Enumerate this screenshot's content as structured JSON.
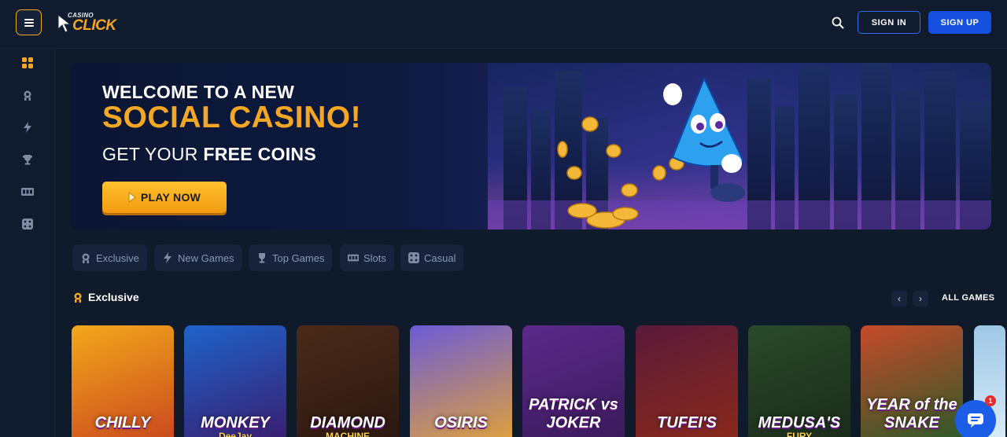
{
  "header": {
    "logo_small": "CASINO",
    "logo_big": "CLICK",
    "signin_label": "SIGN IN",
    "signup_label": "SIGN UP"
  },
  "sidebar": {
    "items": [
      {
        "icon": "grid-icon",
        "active": true
      },
      {
        "icon": "crown-medal-icon",
        "active": false
      },
      {
        "icon": "lightning-icon",
        "active": false
      },
      {
        "icon": "trophy-icon",
        "active": false
      },
      {
        "icon": "slots-icon",
        "active": false
      },
      {
        "icon": "dice-icon",
        "active": false
      }
    ]
  },
  "banner": {
    "line1": "WELCOME TO A NEW",
    "line2": "SOCIAL CASINO!",
    "line3_prefix": "GET YOUR ",
    "line3_bold": "FREE COINS",
    "cta_label": "PLAY NOW"
  },
  "categories": [
    {
      "label": "Exclusive",
      "icon": "crown-medal-icon"
    },
    {
      "label": "New Games",
      "icon": "lightning-icon"
    },
    {
      "label": "Top Games",
      "icon": "trophy-icon"
    },
    {
      "label": "Slots",
      "icon": "slots-icon"
    },
    {
      "label": "Casual",
      "icon": "dice-icon"
    }
  ],
  "section": {
    "title": "Exclusive",
    "all_games_label": "ALL GAMES"
  },
  "games": [
    {
      "title": "CHILLY",
      "subtitle": "",
      "colors": [
        "#f2a81c",
        "#c9471e"
      ]
    },
    {
      "title": "MONKEY",
      "subtitle": "DeeJay",
      "colors": [
        "#1e63c9",
        "#3a1d6e"
      ]
    },
    {
      "title": "DIAMOND",
      "subtitle": "MACHINE",
      "colors": [
        "#4a2a1a",
        "#2a1710"
      ]
    },
    {
      "title": "OSIRIS",
      "subtitle": "",
      "colors": [
        "#6b5bd6",
        "#e0a23a"
      ]
    },
    {
      "title": "PATRICK vs JOKER",
      "subtitle": "",
      "colors": [
        "#5a2a8a",
        "#3a1a5a"
      ]
    },
    {
      "title": "TUFEI'S",
      "subtitle": "",
      "colors": [
        "#5a1a3a",
        "#8a2a1a"
      ]
    },
    {
      "title": "MEDUSA'S",
      "subtitle": "FURY",
      "colors": [
        "#2a4a2a",
        "#1a2a1a"
      ]
    },
    {
      "title": "YEAR of the SNAKE",
      "subtitle": "",
      "colors": [
        "#c64a2a",
        "#2a5a2a"
      ]
    }
  ],
  "chat": {
    "badge": "1"
  },
  "colors": {
    "accent": "#f5a623",
    "primary_blue": "#1650e0",
    "bg": "#0f1a2b"
  }
}
